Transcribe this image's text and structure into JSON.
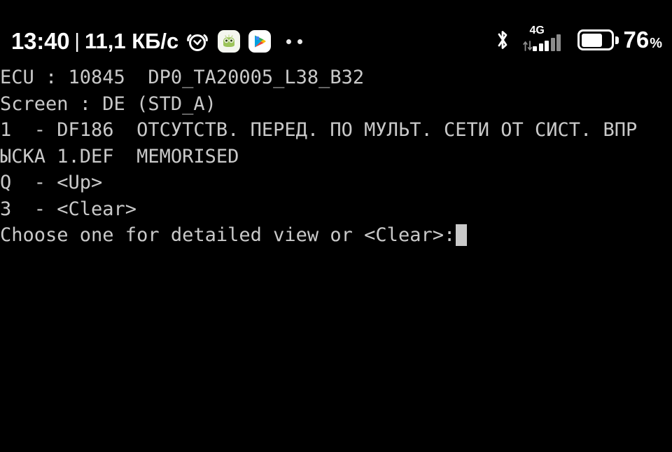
{
  "status_bar": {
    "clock": "13:40",
    "separator": "|",
    "data_rate": "11,1 КБ/с",
    "icons": [
      {
        "name": "alarm-clock-icon",
        "label": "alarm"
      },
      {
        "name": "frog-app-icon",
        "label": "app"
      },
      {
        "name": "google-play-services-icon",
        "label": "play-services"
      }
    ],
    "overflow_dots": "··",
    "bluetooth": "bluetooth-icon",
    "network_type": "4G",
    "signal_bars": 5,
    "signal_bars_filled": 3,
    "battery_percent": "76",
    "battery_percent_sign": "%",
    "battery_level": 70,
    "colors": {
      "background": "#000000",
      "foreground": "#ffffff",
      "dim": "#8c8c8c"
    }
  },
  "terminal": {
    "colors": {
      "background": "#000000",
      "text": "#c9c9c9",
      "cursor": "#c9c9c9"
    },
    "lines": [
      "ECU : 10845  DP0_TA20005_L38_B32",
      "Screen : DE (STD_A)",
      "1  - DF186  ОТСУТСТВ. ПЕРЕД. ПО МУЛЬТ. СЕТИ ОТ СИСТ. ВПР",
      "ЫСКА 1.DEF  MEMORISED",
      "Q  - <Up>",
      "3  - <Clear>"
    ],
    "prompt": "Choose one for detailed view or <Clear>:",
    "cursor": "block"
  }
}
